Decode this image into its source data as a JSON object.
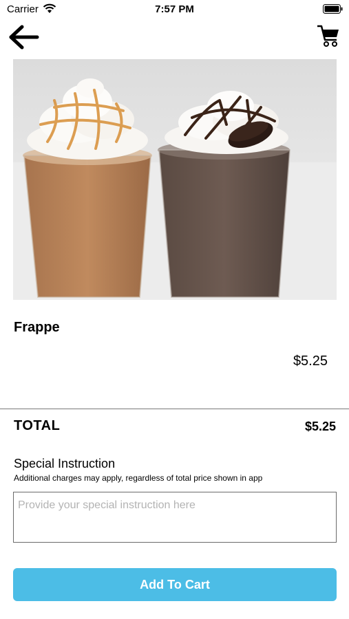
{
  "status_bar": {
    "carrier": "Carrier",
    "time": "7:57 PM",
    "wifi_icon": "wifi-icon",
    "battery_icon": "battery-icon"
  },
  "nav": {
    "back_icon": "arrow-left-icon",
    "cart_icon": "shopping-cart-icon"
  },
  "product": {
    "name": "Frappe",
    "price": "$5.25",
    "image_description": "two-frappe-cups-photo"
  },
  "total": {
    "label": "TOTAL",
    "value": "$5.25"
  },
  "special_instruction": {
    "title": "Special Instruction",
    "note": "Additional charges may apply, regardless of total price shown in app",
    "placeholder": "Provide your special instruction here",
    "value": ""
  },
  "actions": {
    "add_to_cart_label": "Add To Cart"
  },
  "colors": {
    "accent": "#4cbde6",
    "background": "#ffffff",
    "text": "#000000",
    "placeholder": "#b3b3b3"
  }
}
